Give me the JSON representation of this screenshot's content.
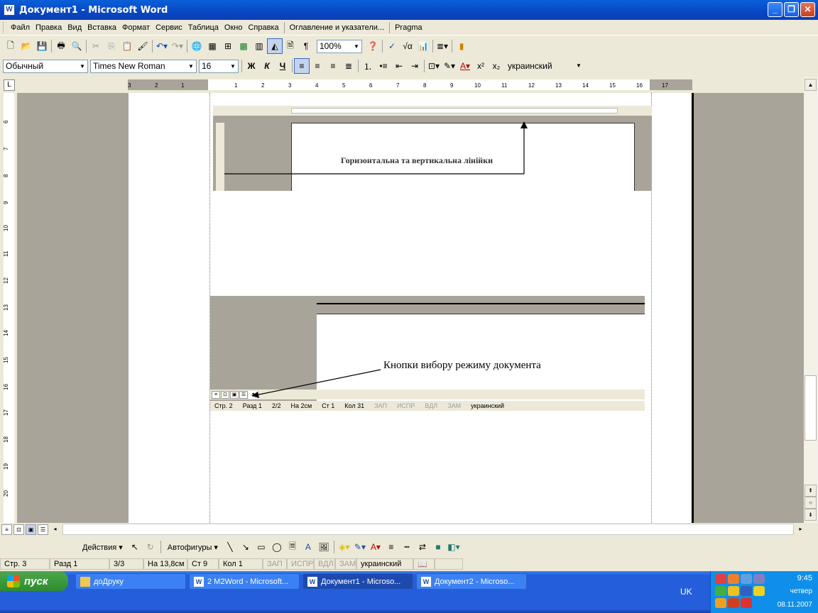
{
  "window": {
    "title": "Документ1 - Microsoft Word",
    "app_icon": "W"
  },
  "menu": [
    "Файл",
    "Правка",
    "Вид",
    "Вставка",
    "Формат",
    "Сервис",
    "Таблица",
    "Окно",
    "Справка",
    "Оглавление и указатели...",
    "Pragma"
  ],
  "toolbar": {
    "zoom": "100%"
  },
  "format": {
    "style": "Обычный",
    "font": "Times New Roman",
    "size": "16",
    "bold": "Ж",
    "italic": "К",
    "underline": "Ч",
    "lang": "украинский"
  },
  "doc": {
    "img1_caption": "Горизонтальна та вертикальна лінійки",
    "img2_caption": "Кнопки вибору режиму документа",
    "img2_status": [
      "Стр. 2",
      "Разд 1",
      "2/2",
      "На 2см",
      "Ст 1",
      "Кол 31",
      "ЗАП",
      "ИСПР",
      "ВДЛ",
      "ЗАМ",
      "украинский"
    ]
  },
  "drawbar": {
    "actions": "Действия ▾",
    "autoshapes": "Автофигуры ▾"
  },
  "status": {
    "page": "Стр. 3",
    "section": "Разд 1",
    "pages": "3/3",
    "at": "На 13,8см",
    "line": "Ст 9",
    "col": "Кол 1",
    "rec": "ЗАП",
    "trk": "ИСПР",
    "ext": "ВДЛ",
    "ovr": "ЗАМ",
    "lang": "украинский"
  },
  "taskbar": {
    "start": "пуск",
    "tasks": [
      "доДруку",
      "2 M2Word - Microsoft...",
      "Документ1 - Microso...",
      "Документ2 - Microso..."
    ],
    "lang": "UK",
    "time": "9:45",
    "day": "четвер",
    "date": "08.11.2007"
  }
}
